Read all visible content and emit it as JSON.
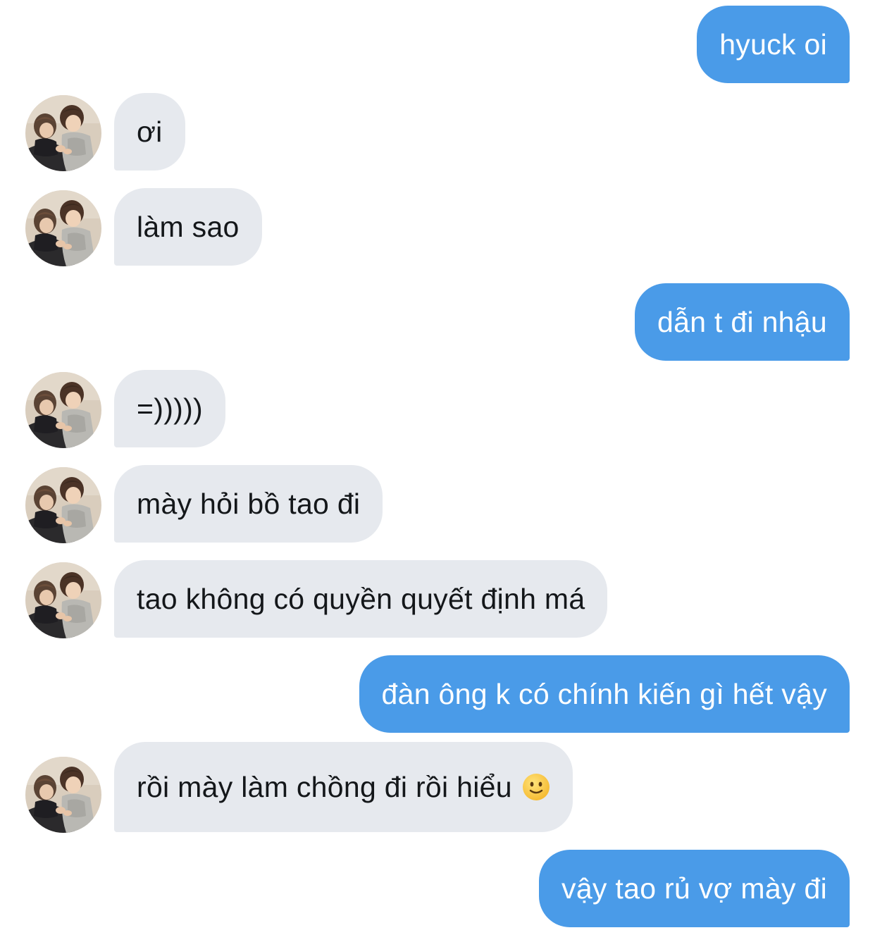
{
  "conversation": {
    "messages": [
      {
        "side": "out",
        "text": "hyuck oi"
      },
      {
        "side": "in",
        "text": "ơi"
      },
      {
        "side": "in",
        "text": "làm sao"
      },
      {
        "side": "out",
        "text": "dẫn t đi nhậu"
      },
      {
        "side": "in",
        "text": "=)))))"
      },
      {
        "side": "in",
        "text": "mày hỏi bồ tao đi"
      },
      {
        "side": "in",
        "text": "tao không có quyền quyết định má"
      },
      {
        "side": "out",
        "text": "đàn ông k có chính kiến gì hết vậy"
      },
      {
        "side": "in",
        "text": "rồi mày làm chồng đi rồi hiểu",
        "emoji": "slightly-smiling-face-icon"
      },
      {
        "side": "out",
        "text": "vậy tao rủ vợ mày đi"
      }
    ]
  },
  "colors": {
    "outgoing_bubble": "#4a9be8",
    "incoming_bubble": "#e6e9ee",
    "outgoing_text": "#ffffff",
    "incoming_text": "#14171a",
    "background": "#ffffff"
  }
}
